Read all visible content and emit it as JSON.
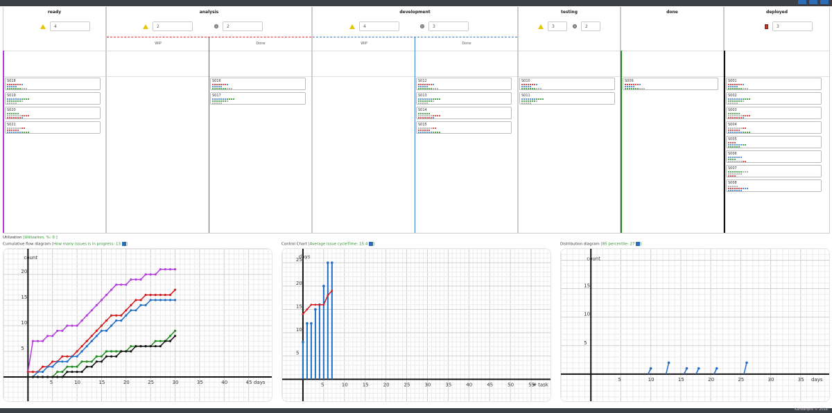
{
  "board": {
    "columns": [
      {
        "key": "ready",
        "title": "ready",
        "limits": [
          {
            "icon": "warning-icon",
            "value": "4"
          }
        ]
      },
      {
        "key": "analysis",
        "title": "analysis",
        "limits": [
          {
            "icon": "warning-icon",
            "value": "2"
          },
          {
            "icon": "gear-icon",
            "value": "2"
          }
        ],
        "sub": [
          "WIP",
          "Done"
        ]
      },
      {
        "key": "development",
        "title": "development",
        "limits": [
          {
            "icon": "warning-icon",
            "value": "4"
          },
          {
            "icon": "gear-icon",
            "value": "3"
          }
        ],
        "sub": [
          "WIP",
          "Done"
        ]
      },
      {
        "key": "testing",
        "title": "testing",
        "limits": [
          {
            "icon": "warning-icon",
            "value": "3"
          },
          {
            "icon": "gear-icon",
            "value": "2"
          }
        ]
      },
      {
        "key": "done",
        "title": "done",
        "limits": []
      },
      {
        "key": "deployed",
        "title": "deployed",
        "limits": [
          {
            "icon": "hourglass-icon",
            "value": "3"
          }
        ]
      }
    ],
    "cards": {
      "ready": [
        "S018",
        "S019",
        "S020",
        "S021"
      ],
      "analysis_done": [
        "S016",
        "S017"
      ],
      "development_done": [
        "S012",
        "S013",
        "S014",
        "S015"
      ],
      "testing": [
        "S010",
        "S011"
      ],
      "done": [
        "S009"
      ],
      "deployed": [
        "S001",
        "S002",
        "S003",
        "S004",
        "S005",
        "S006",
        "S007",
        "S008"
      ]
    }
  },
  "utilization": {
    "label": "Utilization",
    "note": "[Utilization, %: 0 ]"
  },
  "cfd": {
    "label": "Cumulative flow diagram",
    "note": "[How many issues is in progress: 13",
    "note_end": "]"
  },
  "control": {
    "label": "Control Chart",
    "note": "[Average issue cycleTime: 15.4",
    "note_end": "]"
  },
  "distribution": {
    "label": "Distribution diagram",
    "note": "[85 percentile: 27",
    "note_end": "]"
  },
  "footer": {
    "text": "Kanbanpro © 2018"
  },
  "colors": {
    "purple": "#b23cdc",
    "red": "#d0191b",
    "blue": "#1f6cc6",
    "green": "#1c8a1c",
    "black": "#111111",
    "dashed_red": "#e0302f",
    "dashed_blue": "#3a79cc"
  },
  "chart_data": [
    {
      "type": "line",
      "title": "Cumulative flow diagram",
      "xlabel": "days",
      "ylabel": "count",
      "xlim": [
        -5,
        50
      ],
      "ylim": [
        -5,
        25
      ],
      "xticks": [
        "5",
        "10",
        "15",
        "20",
        "25",
        "30",
        "35",
        "40",
        "45"
      ],
      "yticks": [
        "5",
        "10",
        "15",
        "20"
      ],
      "x": [
        0,
        1,
        2,
        3,
        4,
        5,
        6,
        7,
        8,
        9,
        10,
        11,
        12,
        13,
        14,
        15,
        16,
        17,
        18,
        19,
        20,
        21,
        22,
        23,
        24,
        25,
        26,
        27,
        28,
        29,
        30
      ],
      "series": [
        {
          "key": "purple",
          "values": [
            1,
            7,
            7,
            7,
            8,
            8,
            9,
            9,
            10,
            10,
            10,
            11,
            12,
            13,
            14,
            15,
            16,
            17,
            18,
            18,
            18,
            19,
            19,
            19,
            20,
            20,
            20,
            21,
            21,
            21,
            21
          ]
        },
        {
          "key": "red",
          "values": [
            1,
            1,
            1,
            2,
            2,
            3,
            3,
            4,
            4,
            4,
            5,
            6,
            7,
            8,
            9,
            10,
            11,
            12,
            12,
            12,
            13,
            14,
            15,
            15,
            16,
            16,
            16,
            16,
            16,
            16,
            17
          ]
        },
        {
          "key": "blue",
          "values": [
            0,
            0,
            1,
            1,
            2,
            2,
            3,
            3,
            3,
            4,
            4,
            5,
            6,
            7,
            8,
            9,
            9,
            10,
            11,
            11,
            12,
            13,
            13,
            14,
            14,
            15,
            15,
            15,
            15,
            15,
            15
          ]
        },
        {
          "key": "green",
          "values": [
            0,
            0,
            0,
            0,
            0,
            0,
            1,
            1,
            2,
            2,
            2,
            3,
            3,
            3,
            4,
            4,
            5,
            5,
            5,
            5,
            5,
            6,
            6,
            6,
            6,
            6,
            7,
            7,
            7,
            8,
            9
          ]
        },
        {
          "key": "black",
          "values": [
            0,
            0,
            0,
            0,
            0,
            0,
            0,
            0,
            1,
            1,
            1,
            1,
            2,
            2,
            3,
            3,
            4,
            4,
            4,
            5,
            5,
            5,
            6,
            6,
            6,
            6,
            6,
            6,
            7,
            7,
            8
          ]
        }
      ]
    },
    {
      "type": "bar",
      "title": "Control Chart",
      "xlabel": "# task",
      "ylabel": "days",
      "xlim": [
        -5,
        60
      ],
      "ylim": [
        -5,
        28
      ],
      "xticks": [
        "5",
        "10",
        "15",
        "20",
        "25",
        "30",
        "35",
        "40",
        "45",
        "50",
        "55"
      ],
      "yticks": [
        "5",
        "10",
        "15",
        "20",
        "25"
      ],
      "bars": [
        {
          "x": 0,
          "v": 8
        },
        {
          "x": 1,
          "v": 12
        },
        {
          "x": 2,
          "v": 12
        },
        {
          "x": 3,
          "v": 15
        },
        {
          "x": 4,
          "v": 16
        },
        {
          "x": 5,
          "v": 20
        },
        {
          "x": 6,
          "v": 25
        },
        {
          "x": 7,
          "v": 25
        }
      ],
      "avg_line": [
        {
          "x": 0,
          "v": 14
        },
        {
          "x": 1,
          "v": 15
        },
        {
          "x": 2,
          "v": 16
        },
        {
          "x": 3,
          "v": 16
        },
        {
          "x": 4,
          "v": 16
        },
        {
          "x": 5,
          "v": 16
        },
        {
          "x": 6,
          "v": 18
        },
        {
          "x": 7,
          "v": 19
        }
      ]
    },
    {
      "type": "bar",
      "title": "Distribution diagram",
      "xlabel": "days",
      "ylabel": "count",
      "xlim": [
        -5,
        40
      ],
      "ylim": [
        -5,
        22
      ],
      "xticks": [
        "5",
        "10",
        "15",
        "20",
        "25",
        "30",
        "35"
      ],
      "yticks": [
        "5",
        "10",
        "15"
      ],
      "bars": [
        {
          "x": 10,
          "v": 1
        },
        {
          "x": 13,
          "v": 2
        },
        {
          "x": 16,
          "v": 1
        },
        {
          "x": 18,
          "v": 1
        },
        {
          "x": 21,
          "v": 1
        },
        {
          "x": 26,
          "v": 2
        }
      ]
    }
  ]
}
